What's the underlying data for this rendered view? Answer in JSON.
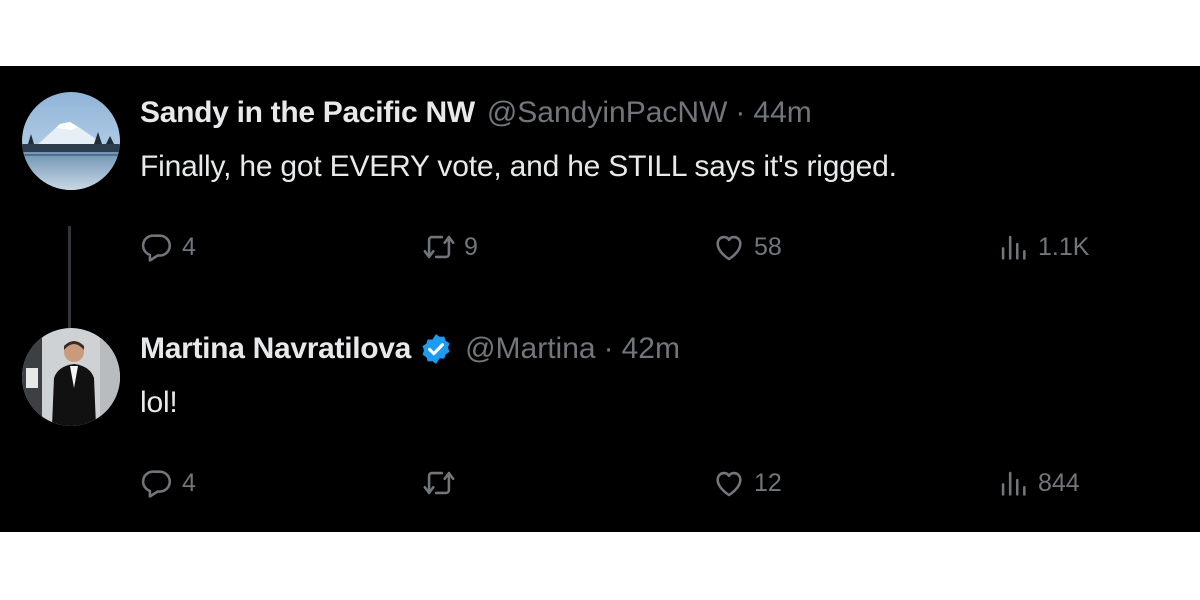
{
  "tweets": [
    {
      "name": "Sandy in the Pacific NW",
      "handle": "@SandyinPacNW",
      "separator": "·",
      "time": "44m",
      "verified": false,
      "text": "Finally, he got EVERY vote, and he STILL says it's rigged.",
      "avatar": "mountain-lake-photo",
      "stats": {
        "replies": "4",
        "retweets": "9",
        "likes": "58",
        "views": "1.1K"
      }
    },
    {
      "name": "Martina Navratilova",
      "handle": "@Martina",
      "separator": "·",
      "time": "42m",
      "verified": true,
      "text": "lol!",
      "avatar": "person-photo",
      "stats": {
        "replies": "4",
        "retweets": "",
        "likes": "12",
        "views": "844"
      }
    }
  ],
  "icons": {
    "reply": "reply-icon",
    "retweet": "retweet-icon",
    "like": "heart-icon",
    "views": "views-icon",
    "verified": "verified-badge-icon"
  },
  "colors": {
    "background": "#000000",
    "primary_text": "#e7e9ea",
    "secondary_text": "#71767b",
    "verified_blue": "#1d9bf0",
    "thread_line": "#333639"
  }
}
